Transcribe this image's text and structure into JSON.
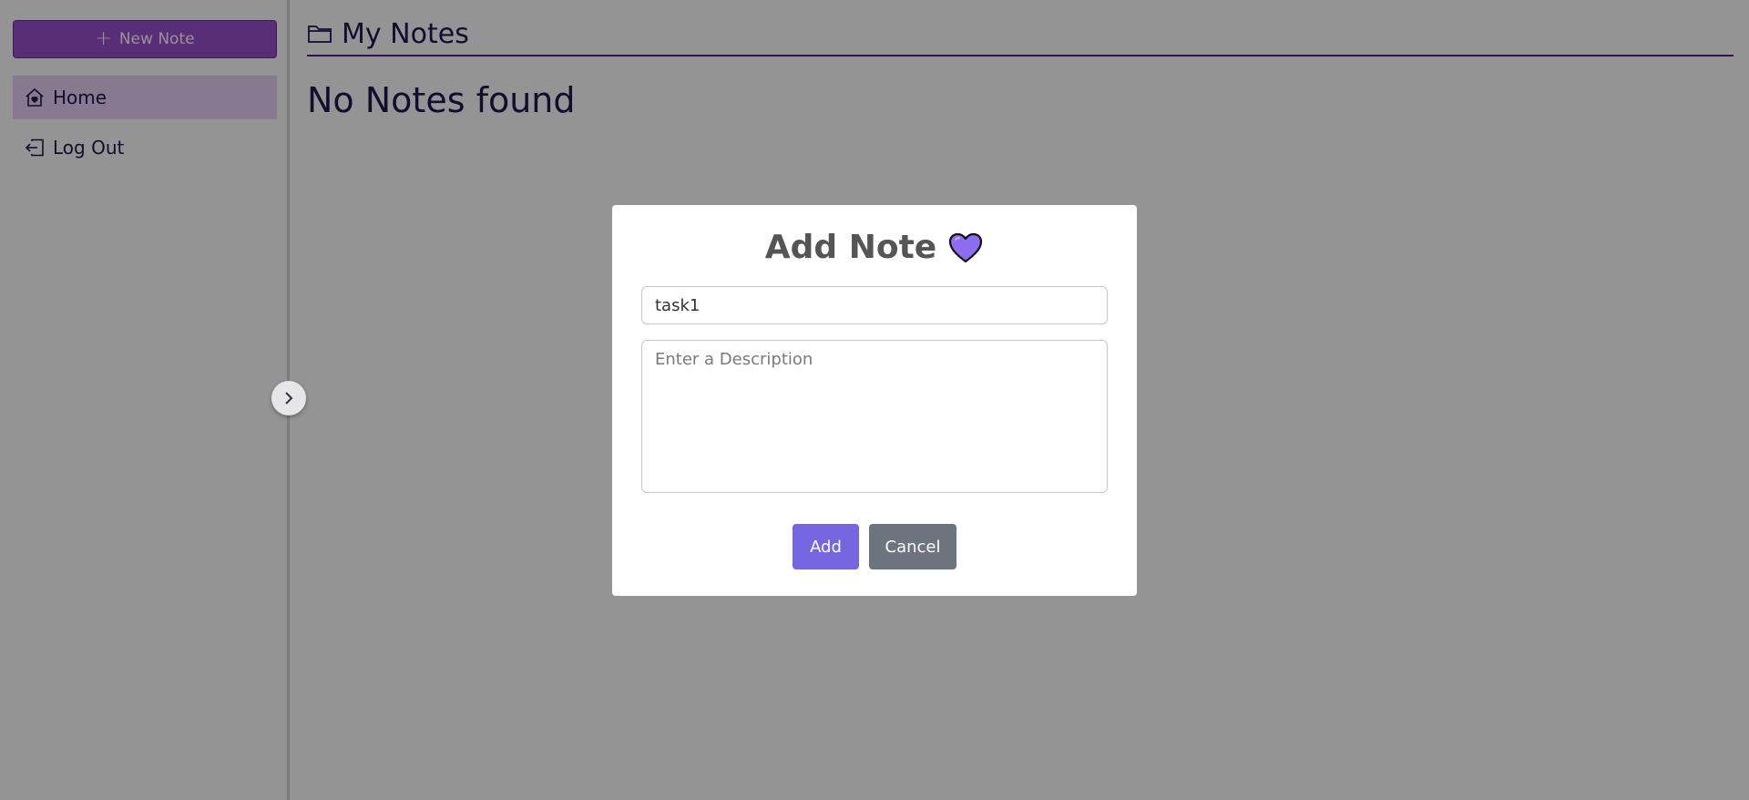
{
  "sidebar": {
    "new_note_label": "New Note",
    "items": [
      {
        "label": "Home",
        "icon": "home-icon",
        "active": true
      },
      {
        "label": "Log Out",
        "icon": "logout-icon",
        "active": false
      }
    ],
    "toggle_icon": "chevron-right-icon"
  },
  "main": {
    "title": "My Notes",
    "title_icon": "folder-icon",
    "empty_message": "No Notes found"
  },
  "modal": {
    "title": "Add Note",
    "title_icon": "heart-icon",
    "title_input_value": "task1",
    "description_placeholder": "Enter a Description",
    "add_label": "Add",
    "cancel_label": "Cancel"
  },
  "colors": {
    "primary_purple": "#9b4fcf",
    "nav_active_bg": "#e9d1f6",
    "text_dark": "#1f1552",
    "add_button": "#7566e0",
    "cancel_button": "#6c757d",
    "heart_fill": "#8c6cf0"
  }
}
